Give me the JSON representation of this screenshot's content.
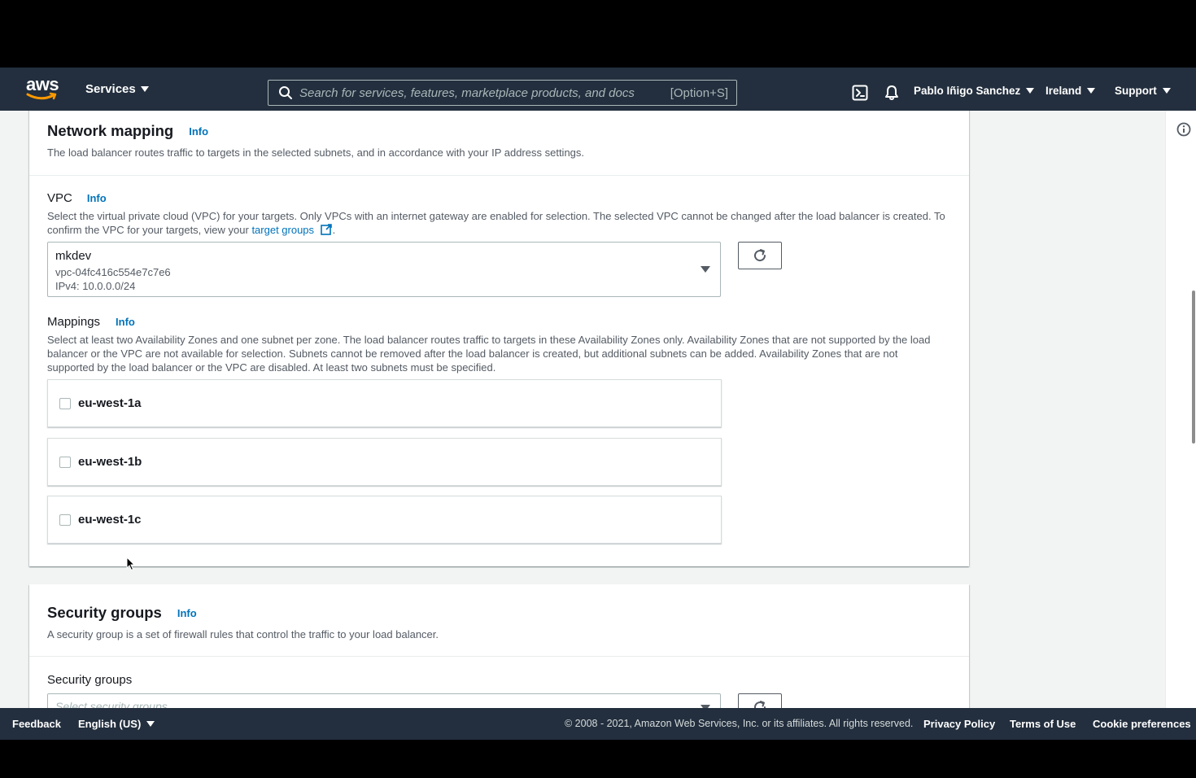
{
  "navbar": {
    "logo_text": "aws",
    "services_label": "Services",
    "search_placeholder": "Search for services, features, marketplace products, and docs",
    "search_shortcut": "[Option+S]",
    "user_label": "Pablo Iñigo Sanchez",
    "region_label": "Ireland",
    "support_label": "Support"
  },
  "network_mapping": {
    "title": "Network mapping",
    "info": "Info",
    "description": "The load balancer routes traffic to targets in the selected subnets, and in accordance with your IP address settings.",
    "vpc": {
      "label": "VPC",
      "info": "Info",
      "description_line1": "Select the virtual private cloud (VPC) for your targets. Only VPCs with an internet gateway are enabled for selection. The selected VPC cannot be changed after the load balancer is created. To",
      "description_line2_prefix": "confirm the VPC for your targets, view your ",
      "target_groups_link": "target groups",
      "description_line2_suffix": ".",
      "selected_name": "mkdev",
      "selected_id": "vpc-04fc416c554e7c7e6",
      "selected_cidr": "IPv4: 10.0.0.0/24"
    },
    "mappings": {
      "label": "Mappings",
      "info": "Info",
      "description_line1": "Select at least two Availability Zones and one subnet per zone. The load balancer routes traffic to targets in these Availability Zones only. Availability Zones that are not supported by the load",
      "description_line2": "balancer or the VPC are not available for selection. Subnets cannot be removed after the load balancer is created, but additional subnets can be added. Availability Zones that are not",
      "description_line3": "supported by the load balancer or the VPC are disabled. At least two subnets must be specified.",
      "zones": [
        {
          "name": "eu-west-1a",
          "checked": false
        },
        {
          "name": "eu-west-1b",
          "checked": false
        },
        {
          "name": "eu-west-1c",
          "checked": false
        }
      ]
    }
  },
  "security_groups": {
    "title": "Security groups",
    "info": "Info",
    "description": "A security group is a set of firewall rules that control the traffic to your load balancer.",
    "field_label": "Security groups",
    "select_placeholder": "Select security groups"
  },
  "footer": {
    "feedback": "Feedback",
    "language": "English (US)",
    "copyright": "© 2008 - 2021, Amazon Web Services, Inc. or its affiliates. All rights reserved.",
    "privacy": "Privacy Policy",
    "terms": "Terms of Use",
    "cookies": "Cookie preferences"
  },
  "colors": {
    "nav_bg": "#232f3e",
    "link": "#0073bb",
    "aws_orange": "#ff9900"
  }
}
